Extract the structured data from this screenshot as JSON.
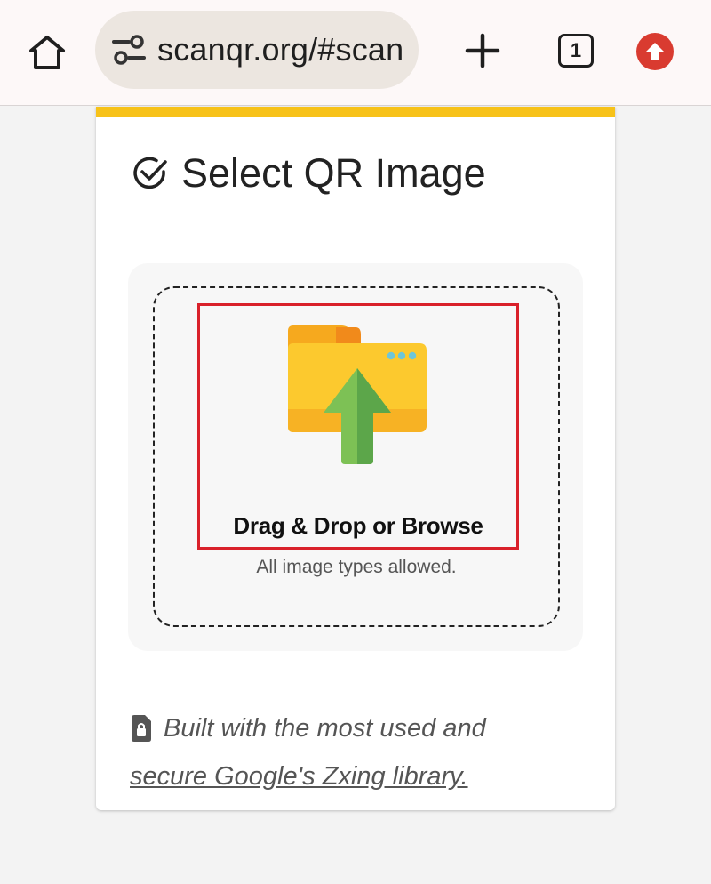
{
  "browser": {
    "url": "scanqr.org/#scan",
    "tab_count": "1",
    "icons": [
      "home-icon",
      "site-settings-icon",
      "new-tab-plus-icon",
      "tab-switcher-icon",
      "update-arrow-icon"
    ],
    "update_color": "#d93b30"
  },
  "card": {
    "accent_color": "#f7c219",
    "title": "Select QR Image",
    "title_icon": "check-circle-icon",
    "upload": {
      "icon": "folder-upload-icon",
      "label": "Drag & Drop or Browse",
      "sublabel": "All image types allowed.",
      "highlight_color": "#d9202a"
    },
    "footer": {
      "icon": "lock-file-icon",
      "text": "Built with the most used and",
      "link": "secure Google's Zxing library."
    }
  }
}
